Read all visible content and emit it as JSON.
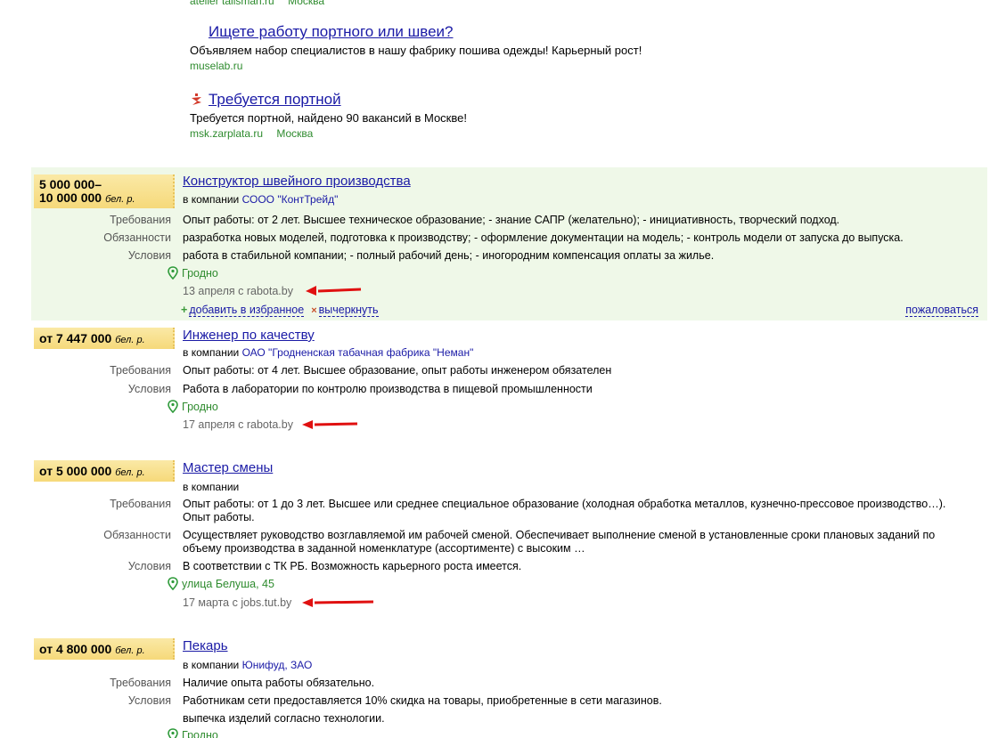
{
  "top_cut": {
    "site": "atelier talisman.ru",
    "city": "Москва"
  },
  "ads": [
    {
      "title": "Ищете работу портного или швеи?",
      "text": "Объявляем набор специалистов в нашу фабрику пошива одежды! Карьерный рост!",
      "url": "muselab.ru",
      "city": ""
    },
    {
      "title": "Требуется портной",
      "text": "Требуется портной, найдено 90 вакансий в Москве!",
      "url": "msk.zarplata.ru",
      "city": "Москва"
    }
  ],
  "labels": {
    "requirements": "Требования",
    "duties": "Обязанности",
    "conditions": "Условия",
    "in_company": "в компании",
    "currency": "бел. р.",
    "add_fav": "добавить в избранное",
    "strike": "вычеркнуть",
    "complain": "пожаловаться"
  },
  "vacancies": [
    {
      "salary_line1": "5 000 000–",
      "salary_line2": "10 000 000",
      "title": "Конструктор швейного производства",
      "company": "СООО \"КонтТрейд\"",
      "requirements": "Опыт работы: от 2 лет. Высшее техническое образование; - знание САПР (желательно); - инициативность, творческий подход.",
      "duties": "разработка новых моделей, подготовка к производству; - оформление документации на модель; - контроль модели от запуска до выпуска.",
      "conditions": "работа в стабильной компании; - полный рабочий день; - иногородним компенсация оплаты за жилье.",
      "location": "Гродно",
      "date": "13 апреля с rabota.by"
    },
    {
      "salary_line1": "от 7 447 000",
      "title": "Инженер по качеству",
      "company": "ОАО \"Гродненская табачная фабрика \"Неман\"",
      "requirements": "Опыт работы: от 4 лет. Высшее образование, опыт работы инженером обязателен",
      "conditions": "Работа в лаборатории по контролю производства в пищевой промышленности",
      "location": "Гродно",
      "date": "17 апреля с rabota.by"
    },
    {
      "salary_line1": "от 5 000 000",
      "title": "Мастер смены",
      "company": "",
      "requirements": "Опыт работы: от 1 до 3 лет. Высшее или среднее специальное образование (холодная обработка металлов, кузнечно-прессовое производство…). Опыт работы.",
      "duties": "Осуществляет руководство возглавляемой им рабочей сменой. Обеспечивает выполнение сменой в установленные сроки плановых заданий по объему производства в заданной номенклатуре (ассортименте) с высоким …",
      "conditions": "В соответствии с ТК РБ. Возможность карьерного роста имеется.",
      "location": "улица Белуша, 45",
      "date": "17 марта с jobs.tut.by"
    },
    {
      "salary_line1": "от 4 800 000",
      "title": "Пекарь",
      "company": "Юнифуд, ЗАО",
      "requirements": "Наличие опыта работы обязательно.",
      "conditions": "Работникам сети предоставляется 10% скидка на товары, приобретенные в сети магазинов.",
      "conditions_extra": "выпечка изделий согласно технологии.",
      "location": "Гродно"
    }
  ],
  "colors": {
    "link": "#1a1aa6",
    "green": "#2e8b2e",
    "salary_bg": "#f6d97a",
    "highlight": "#eff8e8",
    "arrow": "#e01010"
  }
}
